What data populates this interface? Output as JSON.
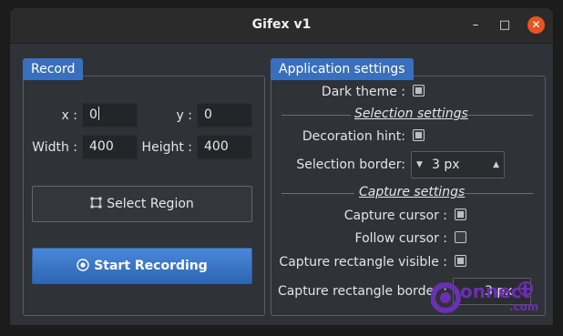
{
  "window": {
    "title": "Gifex v1",
    "min_glyph": "–",
    "max_glyph": "□",
    "close_glyph": "✕"
  },
  "record": {
    "title": "Record",
    "x_label": "x :",
    "x_value": "0",
    "y_label": "y :",
    "y_value": "0",
    "width_label": "Width :",
    "width_value": "400",
    "height_label": "Height :",
    "height_value": "400",
    "select_region_label": "Select Region",
    "start_recording_label": "Start Recording"
  },
  "settings": {
    "title": "Application settings",
    "dark_theme_label": "Dark theme :",
    "dark_theme_checked": true,
    "selection_section": "Selection settings",
    "decoration_hint_label": "Decoration hint:",
    "decoration_hint_checked": true,
    "selection_border_label": "Selection border:",
    "selection_border_value": "3 px",
    "capture_section": "Capture settings",
    "capture_cursor_label": "Capture cursor :",
    "capture_cursor_checked": true,
    "follow_cursor_label": "Follow cursor :",
    "follow_cursor_checked": false,
    "capture_rect_visible_label": "Capture rectangle visible :",
    "capture_rect_visible_checked": true,
    "capture_rect_border_label": "Capture rectangle border :",
    "capture_rect_border_value": "3 px"
  },
  "watermark": {
    "text_big": "onnect",
    "text_small": ".com"
  },
  "colors": {
    "accent": "#3a6fbd",
    "close": "#e95420",
    "watermark": "#6b2fb3"
  }
}
